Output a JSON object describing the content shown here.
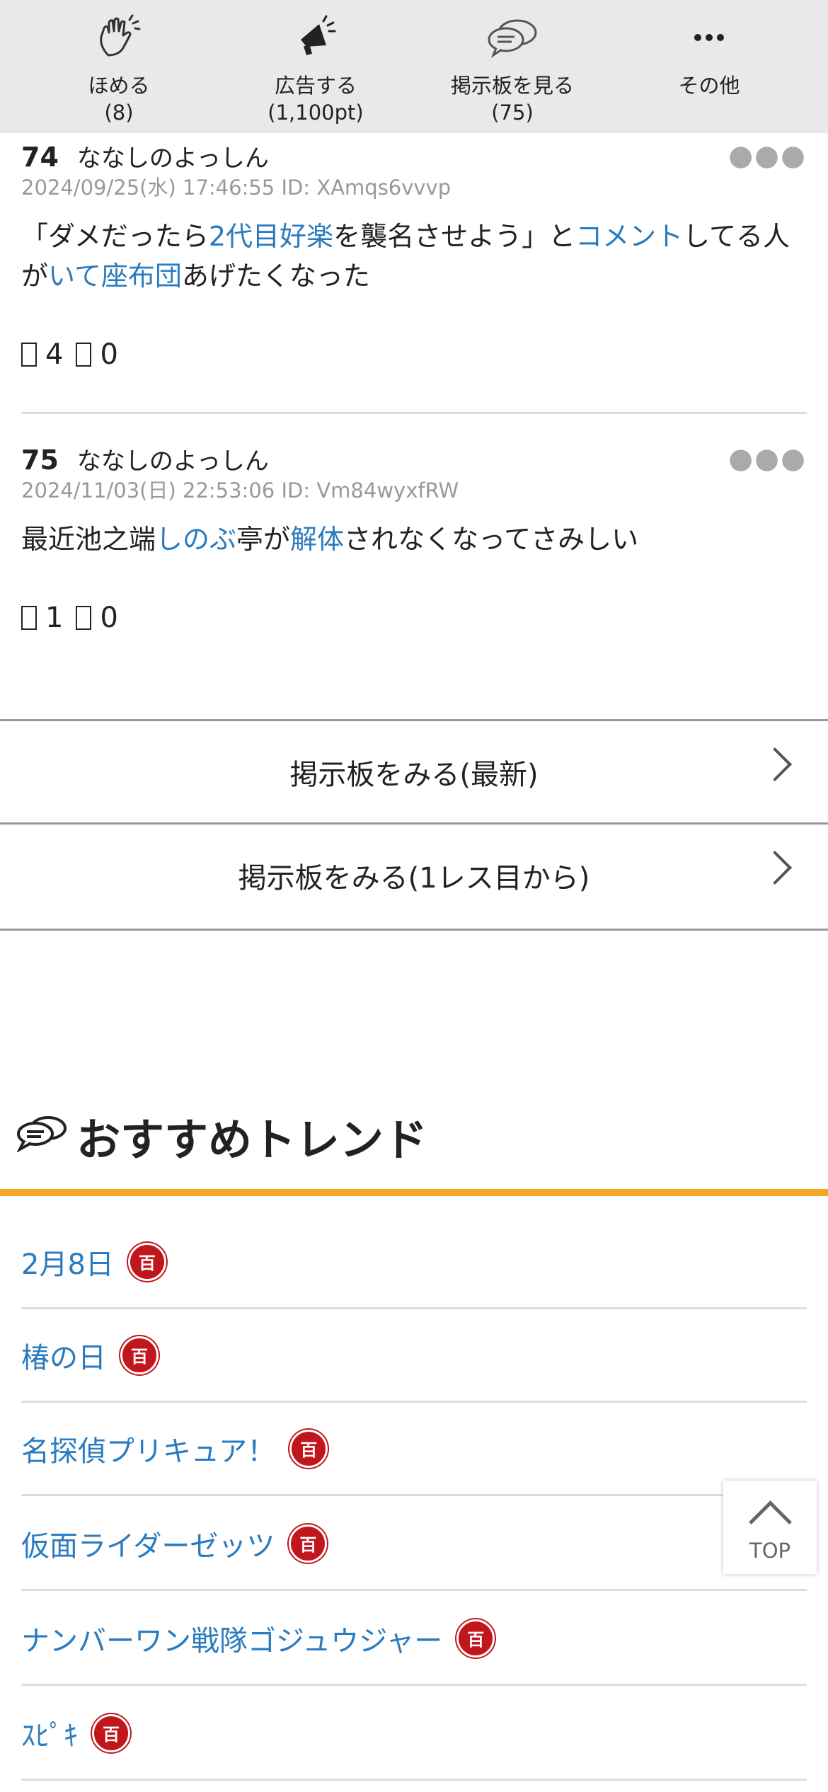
{
  "actions": [
    {
      "label": "ほめる",
      "count": "(8)",
      "icon": "clap-icon"
    },
    {
      "label": "広告する",
      "count": "(1,100pt)",
      "icon": "megaphone-icon"
    },
    {
      "label": "掲示板を見る",
      "count": "(75)",
      "icon": "chat-bubbles-icon"
    },
    {
      "label": "その他",
      "count": "",
      "icon": "more-dots-icon"
    }
  ],
  "posts": [
    {
      "num": "74",
      "name": "ななしのよっしん",
      "meta": "2024/09/25(水) 17:46:55 ID: XAmqs6vvvp",
      "body_parts": [
        {
          "t": "「ダメだったら",
          "link": false
        },
        {
          "t": "2代目好楽",
          "link": true
        },
        {
          "t": "を襲名させよう」と",
          "link": false
        },
        {
          "t": "コメント",
          "link": true
        },
        {
          "t": "してる人が",
          "link": false
        },
        {
          "t": "いて",
          "link": true
        },
        {
          "t": "座布団",
          "link": true
        },
        {
          "t": "あげたくなった",
          "link": false
        }
      ],
      "good": "4",
      "bad": "0"
    },
    {
      "num": "75",
      "name": "ななしのよっしん",
      "meta": "2024/11/03(日) 22:53:06 ID: Vm84wyxfRW",
      "body_parts": [
        {
          "t": "最近池之端",
          "link": false
        },
        {
          "t": "しのぶ",
          "link": true
        },
        {
          "t": "亭が",
          "link": false
        },
        {
          "t": "解体",
          "link": true
        },
        {
          "t": "されなくなってさみしい",
          "link": false
        }
      ],
      "good": "1",
      "bad": "0"
    }
  ],
  "board_buttons": {
    "latest": "掲示板をみる(最新)",
    "from_first": "掲示板をみる(1レス目から)"
  },
  "trends": {
    "title": "おすすめトレンド",
    "badge": "百",
    "items": [
      "2月8日",
      "椿の日",
      "名探偵プリキュア！",
      "仮面ライダーゼッツ",
      "ナンバーワン戦隊ゴジュウジャー",
      "ｽﾋﾟｷ"
    ]
  },
  "top_button": "TOP",
  "colors": {
    "link": "#2a7bbf",
    "accent_bar": "#f5a623",
    "badge": "#c0161c",
    "topbar_bg": "#e9e9e9"
  }
}
